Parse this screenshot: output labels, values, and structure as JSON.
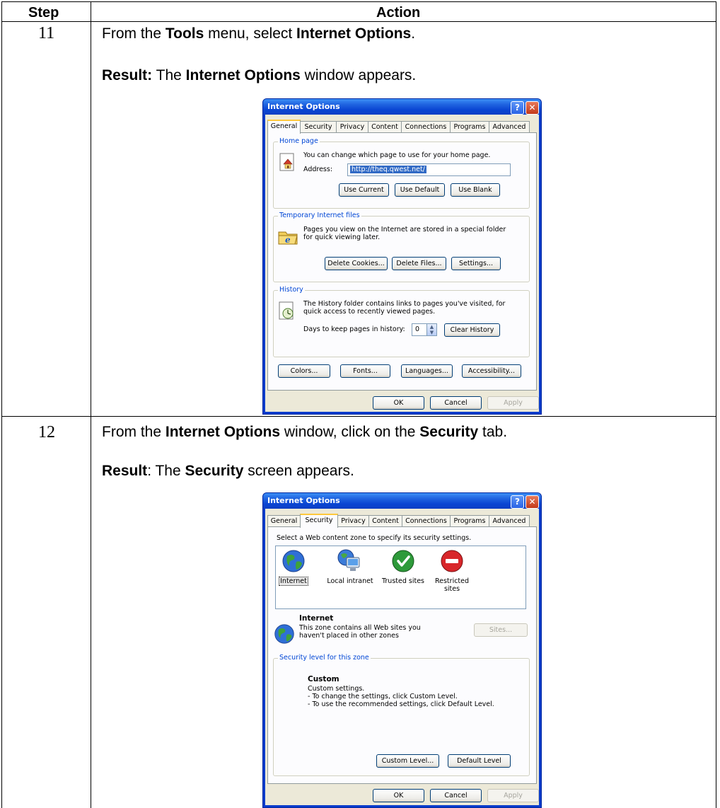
{
  "table": {
    "header_step": "Step",
    "header_action": "Action"
  },
  "step11": {
    "number": "11",
    "line1": {
      "p1": "From the ",
      "b1": "Tools",
      "p2": " menu, select ",
      "b2": "Internet Options",
      "p3": "."
    },
    "line2": {
      "b1": "Result:",
      "p1": "  The ",
      "b2": "Internet Options",
      "p2": " window appears."
    },
    "dialog": {
      "title": "Internet Options",
      "help_btn": "?",
      "close_btn": "✕",
      "tabs": [
        "General",
        "Security",
        "Privacy",
        "Content",
        "Connections",
        "Programs",
        "Advanced"
      ],
      "active_tab": "General",
      "home_page": {
        "title": "Home page",
        "desc": "You can change which page to use for your home page.",
        "address_label": "Address:",
        "address_value": "http://theq.qwest.net/",
        "btn_current": "Use Current",
        "btn_default": "Use Default",
        "btn_blank": "Use Blank"
      },
      "temp_files": {
        "title": "Temporary Internet files",
        "desc1": "Pages you view on the Internet are stored in a special folder",
        "desc2": "for quick viewing later.",
        "btn_cookies": "Delete Cookies...",
        "btn_files": "Delete Files...",
        "btn_settings": "Settings..."
      },
      "history": {
        "title": "History",
        "desc1": "The History folder contains links to pages you've visited, for",
        "desc2": "quick access to recently viewed pages.",
        "days_label": "Days to keep pages in history:",
        "days_value": "0",
        "btn_clear": "Clear History"
      },
      "bottom_buttons": {
        "colors": "Colors...",
        "fonts": "Fonts...",
        "languages": "Languages...",
        "accessibility": "Accessibility..."
      },
      "ok": "OK",
      "cancel": "Cancel",
      "apply": "Apply"
    }
  },
  "step12": {
    "number": "12",
    "line1": {
      "p1": "From the ",
      "b1": "Internet Options",
      "p2": " window, click on the ",
      "b2": "Security",
      "p3": " tab."
    },
    "line2": {
      "b1": "Result",
      "p1": ":  The ",
      "b2": "Security",
      "p2": " screen appears."
    },
    "dialog": {
      "title": "Internet Options",
      "help_btn": "?",
      "close_btn": "✕",
      "tabs": [
        "General",
        "Security",
        "Privacy",
        "Content",
        "Connections",
        "Programs",
        "Advanced"
      ],
      "active_tab": "Security",
      "instruction": "Select a Web content zone to specify its security settings.",
      "zones": [
        {
          "label": "Internet",
          "icon": "globe-icon"
        },
        {
          "label": "Local intranet",
          "icon": "monitor-icon"
        },
        {
          "label": "Trusted sites",
          "icon": "checkmark-icon"
        },
        {
          "label": "Restricted sites",
          "icon": "no-entry-icon"
        }
      ],
      "selected_zone": "Internet",
      "zone_title": "Internet",
      "zone_desc1": "This zone contains all Web sites you",
      "zone_desc2": "haven't placed in other zones",
      "sites_btn": "Sites...",
      "level_group": "Security level for this zone",
      "level_name": "Custom",
      "level_desc1": "Custom settings.",
      "level_desc2": "- To change the settings, click Custom Level.",
      "level_desc3": "- To use the recommended settings, click Default Level.",
      "custom_level_btn": "Custom Level...",
      "default_level_btn": "Default Level",
      "ok": "OK",
      "cancel": "Cancel",
      "apply": "Apply"
    }
  }
}
